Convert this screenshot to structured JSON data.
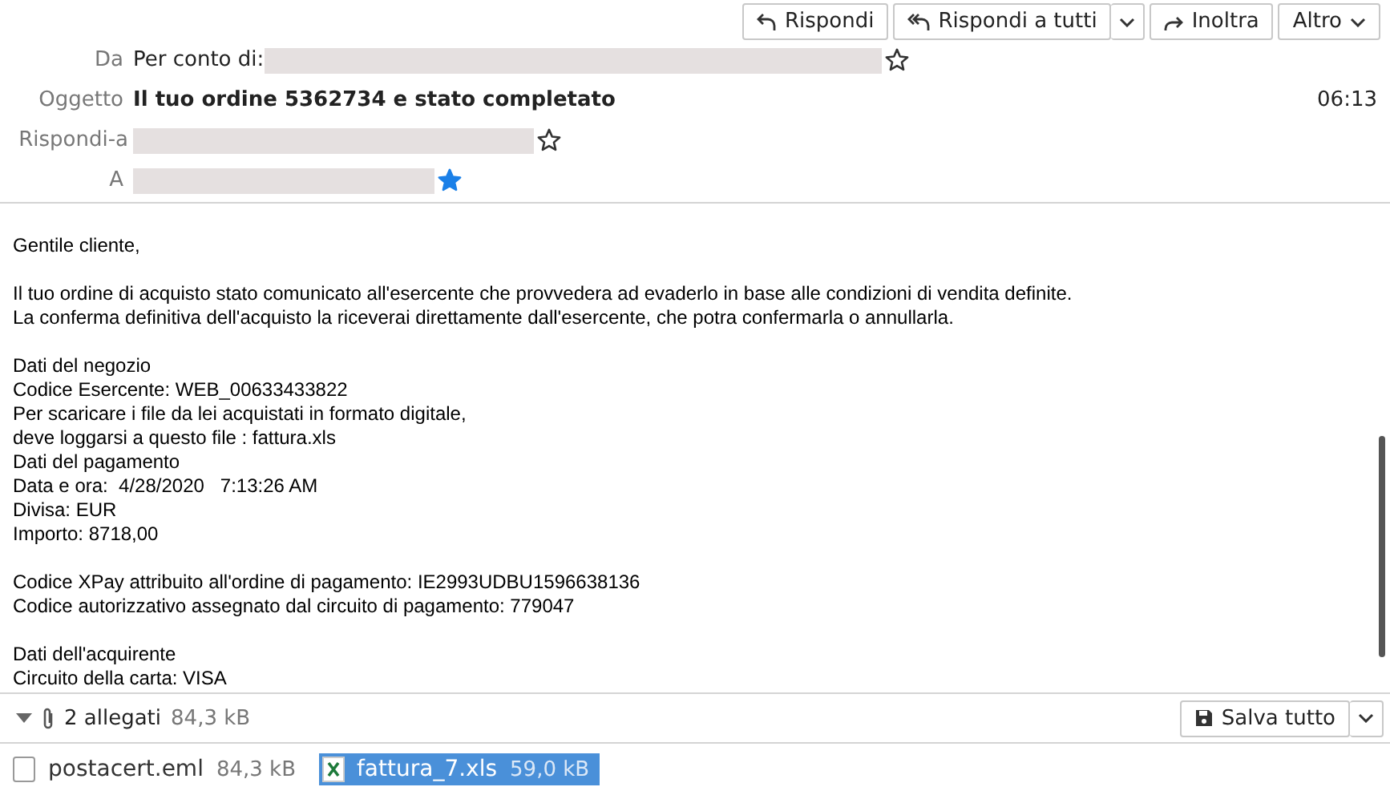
{
  "toolbar": {
    "buttons": [
      {
        "label": "Rispondi",
        "kind": "reply"
      },
      {
        "label": "Rispondi a tutti",
        "kind": "reply-all"
      },
      {
        "label": "Inoltra",
        "kind": "forward"
      },
      {
        "label": "Altro",
        "kind": "more"
      }
    ]
  },
  "headers": [
    {
      "label": "Da",
      "value": "Per conto di:",
      "starred": false,
      "kind": "from"
    },
    {
      "label": "Oggetto",
      "value": "Il tuo ordine 5362734 e stato completato",
      "time": "06:13",
      "kind": "subject"
    },
    {
      "label": "Rispondi-a",
      "starred": false,
      "kind": "address"
    },
    {
      "label": "A",
      "starred": true,
      "kind": "address"
    }
  ],
  "body": [
    [
      "Gentile cliente,"
    ],
    [
      "Il tuo ordine di acquisto stato comunicato all'esercente che provvedera ad evaderlo in base alle condizioni di vendita definite.",
      "La conferma definitiva dell'acquisto la riceverai direttamente dall'esercente, che potra confermarla o annullarla."
    ],
    [
      "Dati del negozio",
      "Codice Esercente: WEB_00633433822",
      "Per scaricare i file da lei acquistati in formato digitale,",
      "deve loggarsi a questo file : fattura.xls",
      "Dati del pagamento",
      "Data e ora:  4/28/2020   7:13:26 AM",
      "Divisa: EUR",
      "Importo: 8718,00"
    ],
    [
      "Codice XPay attribuito all'ordine di pagamento: IE2993UDBU1596638136",
      "Codice autorizzativo assegnato dal circuito di pagamento: 779047"
    ],
    [
      "Dati dell'acquirente",
      "Circuito della carta: VISA"
    ]
  ],
  "attachments_bar": {
    "expanded": true,
    "count": "2 allegati",
    "size": "84,3 kB",
    "save_button": "Salva tutto"
  },
  "attachments": [
    {
      "name": "postacert.eml",
      "size": "84,3 kB",
      "kind": "eml",
      "selected": false
    },
    {
      "name": "fattura_7.xls",
      "size": "59,0 kB",
      "kind": "xls",
      "selected": true
    }
  ]
}
